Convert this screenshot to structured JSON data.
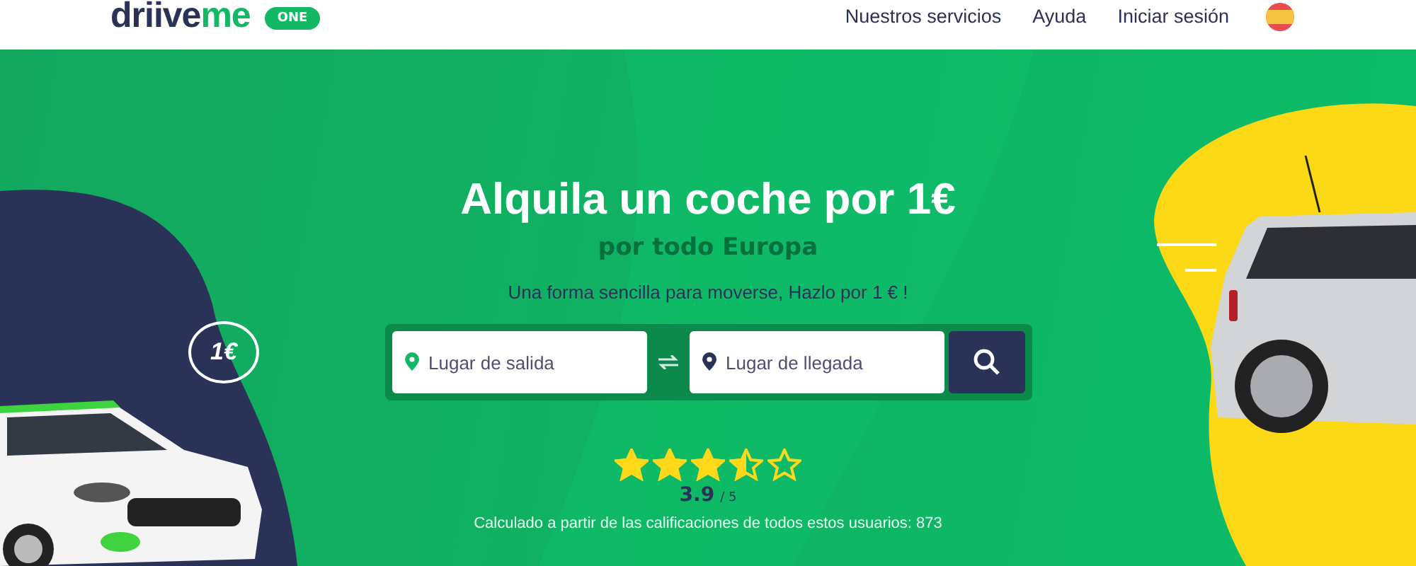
{
  "header": {
    "logo": {
      "parts": [
        "driive",
        "me"
      ],
      "badge": "ONE"
    },
    "nav": [
      "Nuestros servicios",
      "Ayuda",
      "Iniciar sesión"
    ]
  },
  "hero": {
    "title": "Alquila un coche por 1€",
    "subtitle": "por todo Europa",
    "tagline": "Una forma sencilla para moverse, Hazlo por 1 € !",
    "search": {
      "from_placeholder": "Lugar de salida",
      "to_placeholder": "Lugar de llegada"
    },
    "rating": {
      "stars": 3.5,
      "score": "3.9",
      "out_of": "/ 5",
      "caption": "Calculado a partir de las calificaciones de todos estos usuarios: 873"
    },
    "bubble": "1€"
  }
}
